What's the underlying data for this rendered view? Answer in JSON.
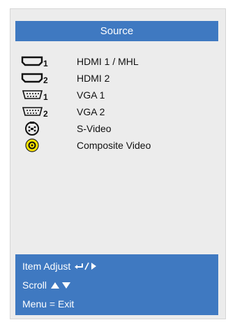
{
  "menu": {
    "title": "Source",
    "items": [
      {
        "label": "HDMI 1 / MHL",
        "icon": "hdmi-1-icon",
        "index": "1"
      },
      {
        "label": "HDMI 2",
        "icon": "hdmi-2-icon",
        "index": "2"
      },
      {
        "label": "VGA 1",
        "icon": "vga-1-icon",
        "index": "1"
      },
      {
        "label": "VGA 2",
        "icon": "vga-2-icon",
        "index": "2"
      },
      {
        "label": "S-Video",
        "icon": "s-video-icon"
      },
      {
        "label": "Composite Video",
        "icon": "composite-video-icon"
      }
    ]
  },
  "help": {
    "item_adjust": "Item Adjust",
    "scroll": "Scroll",
    "menu_exit": "Menu = Exit"
  },
  "colors": {
    "accent": "#3f79c1",
    "panel": "#ececec",
    "composite_yellow": "#ffe600"
  }
}
